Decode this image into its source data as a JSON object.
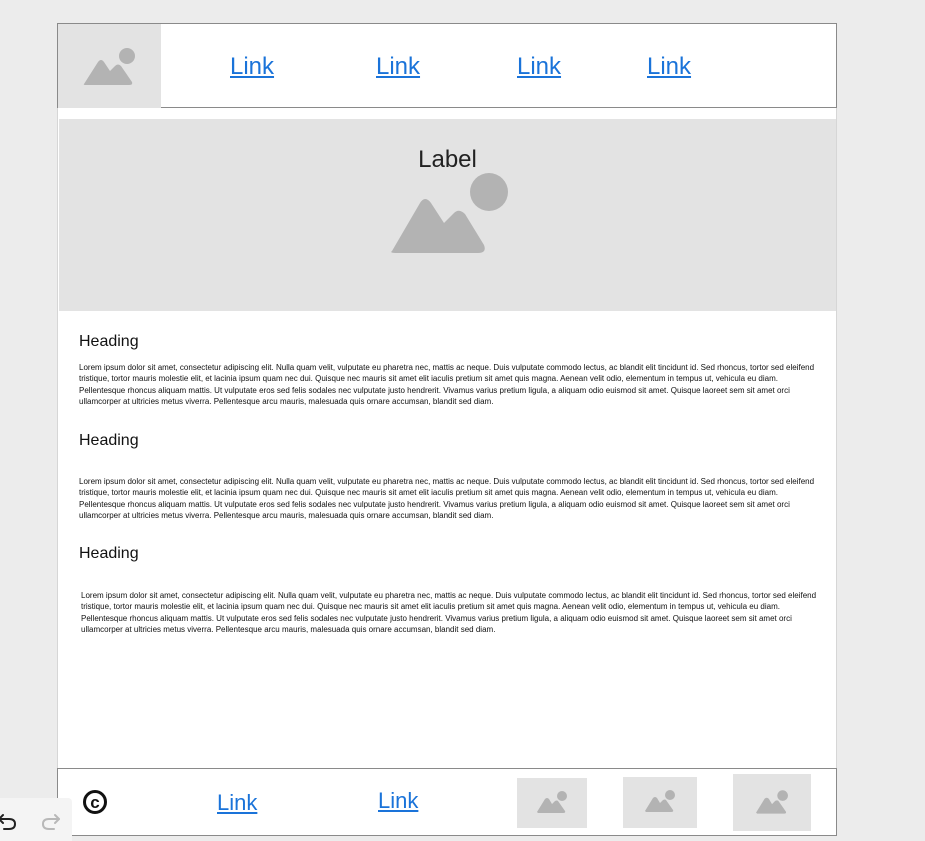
{
  "header": {
    "logo_icon": "image-placeholder-icon",
    "nav_links": [
      "Link",
      "Link",
      "Link",
      "Link"
    ]
  },
  "hero": {
    "label": "Label",
    "image_icon": "image-placeholder-icon"
  },
  "sections": [
    {
      "heading": "Heading",
      "body": "Lorem ipsum dolor sit amet, consectetur adipiscing elit. Nulla quam velit, vulputate eu pharetra nec, mattis ac neque. Duis vulputate commodo lectus, ac blandit elit tincidunt id. Sed rhoncus, tortor sed eleifend tristique, tortor mauris molestie elit, et lacinia ipsum quam nec dui. Quisque nec mauris sit amet elit iaculis pretium sit amet quis magna. Aenean velit odio, elementum in tempus ut, vehicula eu diam. Pellentesque rhoncus aliquam mattis. Ut vulputate eros sed felis sodales nec vulputate justo hendrerit. Vivamus varius pretium ligula, a aliquam odio euismod sit amet. Quisque laoreet sem sit amet orci ullamcorper at ultricies metus viverra. Pellentesque arcu mauris, malesuada quis ornare accumsan, blandit sed diam."
    },
    {
      "heading": "Heading",
      "body": "Lorem ipsum dolor sit amet, consectetur adipiscing elit. Nulla quam velit, vulputate eu pharetra nec, mattis ac neque. Duis vulputate commodo lectus, ac blandit elit tincidunt id. Sed rhoncus, tortor sed eleifend tristique, tortor mauris molestie elit, et lacinia ipsum quam nec dui. Quisque nec mauris sit amet elit iaculis pretium sit amet quis magna. Aenean velit odio, elementum in tempus ut, vehicula eu diam. Pellentesque rhoncus aliquam mattis. Ut vulputate eros sed felis sodales nec vulputate justo hendrerit. Vivamus varius pretium ligula, a aliquam odio euismod sit amet. Quisque laoreet sem sit amet orci ullamcorper at ultricies metus viverra. Pellentesque arcu mauris, malesuada quis ornare accumsan, blandit sed diam."
    },
    {
      "heading": "Heading",
      "body": "Lorem ipsum dolor sit amet, consectetur adipiscing elit. Nulla quam velit, vulputate eu pharetra nec, mattis ac neque. Duis vulputate commodo lectus, ac blandit elit tincidunt id. Sed rhoncus, tortor sed eleifend tristique, tortor mauris molestie elit, et lacinia ipsum quam nec dui. Quisque nec mauris sit amet elit iaculis pretium sit amet quis magna. Aenean velit odio, elementum in tempus ut, vehicula eu diam. Pellentesque rhoncus aliquam mattis. Ut vulputate eros sed felis sodales nec vulputate justo hendrerit. Vivamus varius pretium ligula, a aliquam odio euismod sit amet. Quisque laoreet sem sit amet orci ullamcorper at ultricies metus viverra. Pellentesque arcu mauris, malesuada quis ornare accumsan, blandit sed diam."
    }
  ],
  "footer": {
    "copyright_symbol": "c",
    "links": [
      "Link",
      "Link"
    ],
    "thumb_icons": [
      "image-placeholder-icon",
      "image-placeholder-icon",
      "image-placeholder-icon"
    ]
  },
  "editor_controls": {
    "undo_icon": "undo-icon",
    "redo_icon": "redo-icon"
  },
  "colors": {
    "link": "#1a73d9",
    "placeholder_bg": "#e3e3e3",
    "placeholder_icon": "#b3b3b3",
    "page_bg": "#ececec"
  }
}
